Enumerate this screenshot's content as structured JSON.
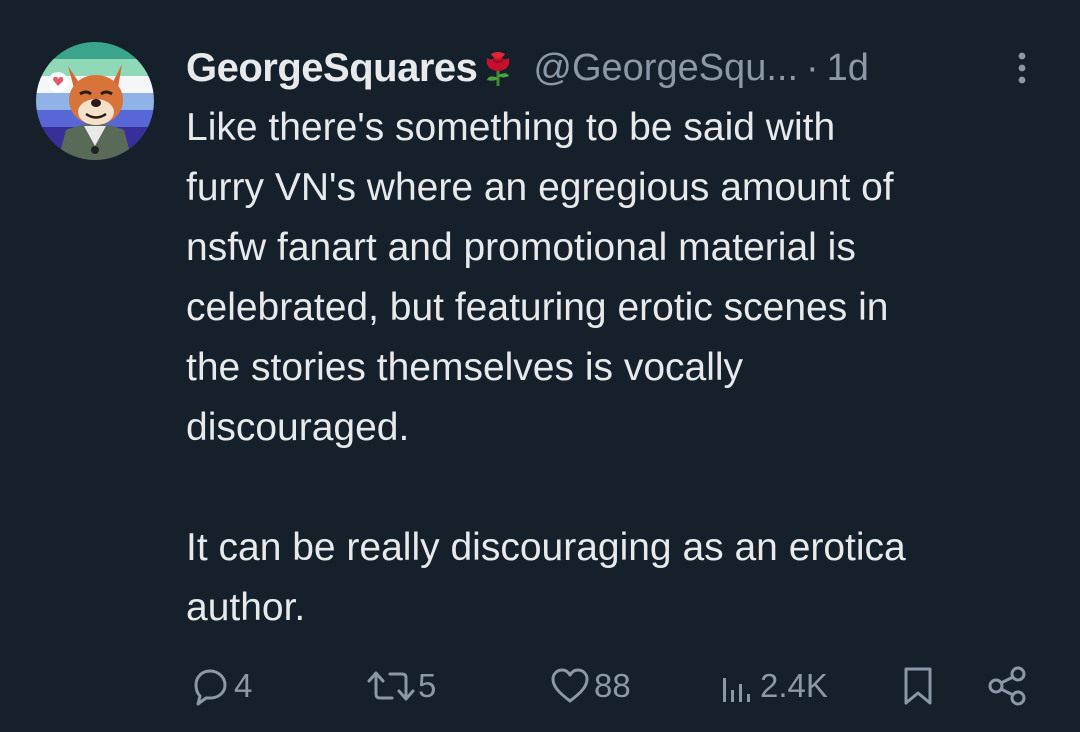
{
  "tweet": {
    "author": {
      "display_name": "GeorgeSquares",
      "handle": "@GeorgeSqu...",
      "emoji_icon": "rose-icon"
    },
    "separator": "·",
    "timestamp": "1d",
    "text": "Like there's something to be said with\nfurry VN's where an egregious amount of\nnsfw fanart and promotional material is\ncelebrated, but featuring erotic scenes in\nthe stories themselves is vocally\ndiscouraged.\n\nIt can be really discouraging as an erotica\nauthor.",
    "stats": {
      "replies": "4",
      "retweets": "5",
      "likes": "88",
      "views": "2.4K"
    }
  },
  "colors": {
    "background": "#16202b",
    "text": "#e7e9ea",
    "muted": "#8b98a5"
  }
}
